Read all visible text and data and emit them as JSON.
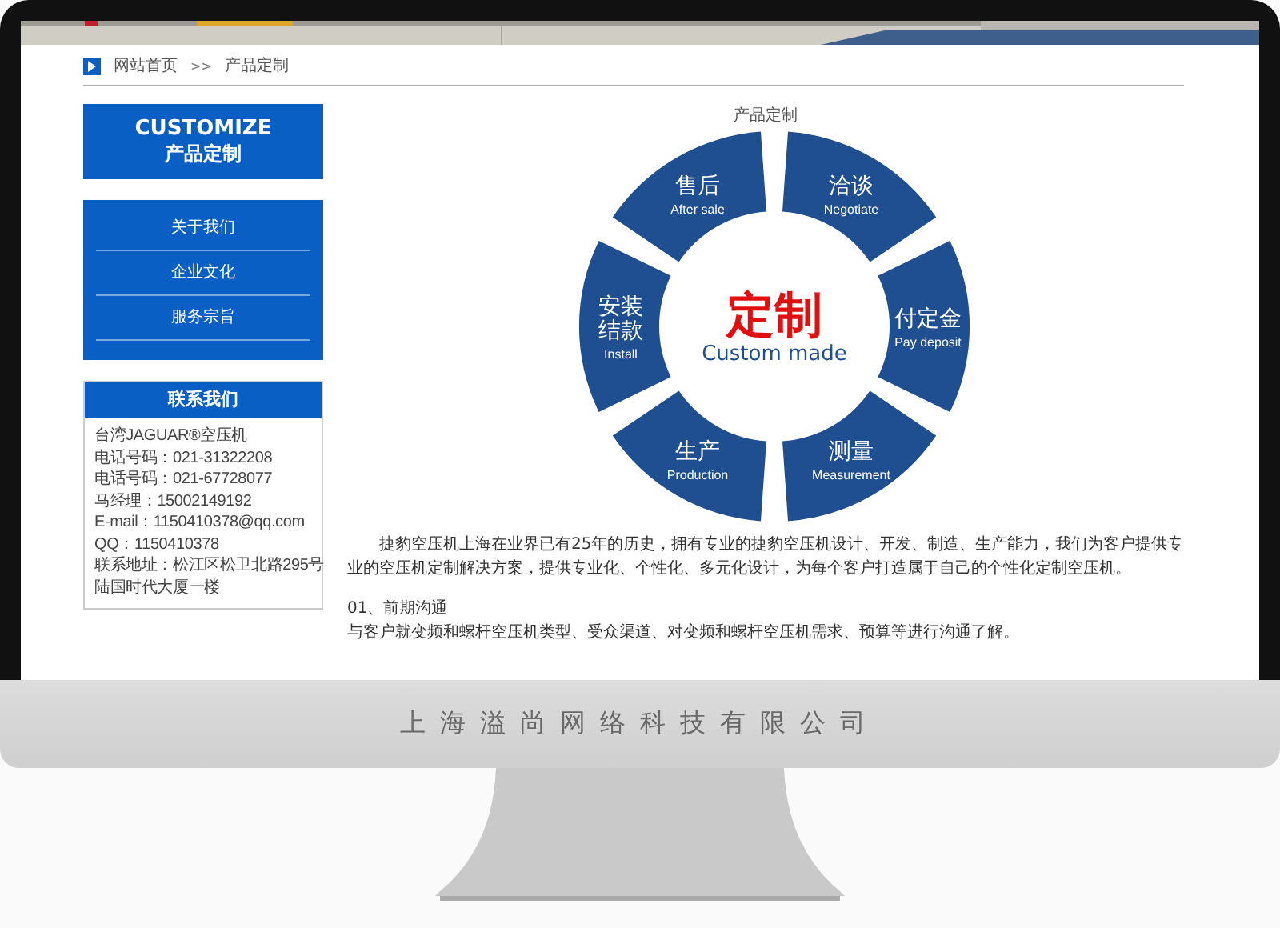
{
  "breadcrumb": {
    "home": "网站首页",
    "separator": ">>",
    "current": "产品定制"
  },
  "sidebar": {
    "banner": {
      "title": "CUSTOMIZE",
      "subtitle": "产品定制"
    },
    "nav_items": [
      "关于我们",
      "企业文化",
      "服务宗旨"
    ],
    "contact": {
      "heading": "联系我们",
      "lines": [
        "台湾JAGUAR®空压机",
        "电话号码：021-31322208",
        "电话号码：021-67728077",
        "马经理：15002149192",
        "E-mail：1150410378@qq.com",
        "QQ：1150410378",
        "联系地址：松江区松卫北路295号",
        "陆国时代大厦一楼"
      ]
    }
  },
  "main": {
    "title": "产品定制",
    "diagram": {
      "center_title": "定制",
      "center_caption": "Custom made",
      "segments": [
        {
          "title_lines": [
            "售后"
          ],
          "caption": "After sale"
        },
        {
          "title_lines": [
            "洽谈"
          ],
          "caption": "Negotiate"
        },
        {
          "title_lines": [
            "安装",
            "结款"
          ],
          "caption": "Install"
        },
        {
          "title_lines": [
            "付定金"
          ],
          "caption": "Pay deposit"
        },
        {
          "title_lines": [
            "生产"
          ],
          "caption": "Production"
        },
        {
          "title_lines": [
            "测量"
          ],
          "caption": "Measurement"
        }
      ]
    },
    "intro": "捷豹空压机上海在业界已有25年的历史，拥有专业的捷豹空压机设计、开发、制造、生产能力，我们为客户提供专业的空压机定制解决方案，提供专业化、个性化、多元化设计，为每个客户打造属于自己的个性化定制空压机。",
    "steps": [
      {
        "heading": "01、前期沟通",
        "text": "与客户就变频和螺杆空压机类型、受众渠道、对变频和螺杆空压机需求、预算等进行沟通了解。"
      }
    ]
  },
  "monitor": {
    "brand": "上海溢尚网络科技有限公司"
  }
}
